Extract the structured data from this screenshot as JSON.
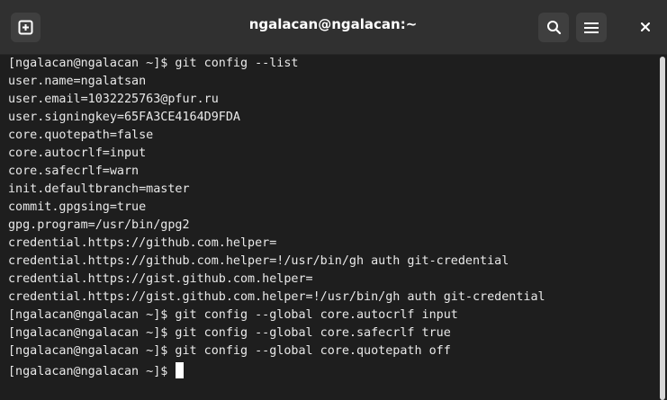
{
  "window": {
    "title": "ngalacan@ngalacan:~",
    "icons": {
      "new_tab": "new-tab-icon",
      "search": "search-icon",
      "menu": "hamburger-menu-icon",
      "close": "close-icon"
    },
    "colors": {
      "titlebar": "#303030",
      "terminal_bg": "#1e1e1e",
      "text": "#e9e9e9"
    }
  },
  "terminal": {
    "lines": [
      "[ngalacan@ngalacan ~]$ git config --list",
      "user.name=ngalatsan",
      "user.email=1032225763@pfur.ru",
      "user.signingkey=65FA3CE4164D9FDA",
      "core.quotepath=false",
      "core.autocrlf=input",
      "core.safecrlf=warn",
      "init.defaultbranch=master",
      "commit.gpgsing=true",
      "gpg.program=/usr/bin/gpg2",
      "credential.https://github.com.helper=",
      "credential.https://github.com.helper=!/usr/bin/gh auth git-credential",
      "credential.https://gist.github.com.helper=",
      "credential.https://gist.github.com.helper=!/usr/bin/gh auth git-credential",
      "[ngalacan@ngalacan ~]$ git config --global core.autocrlf input",
      "[ngalacan@ngalacan ~]$ git config --global core.safecrlf true",
      "[ngalacan@ngalacan ~]$ git config --global core.quotepath off"
    ],
    "prompt": "[ngalacan@ngalacan ~]$ "
  }
}
